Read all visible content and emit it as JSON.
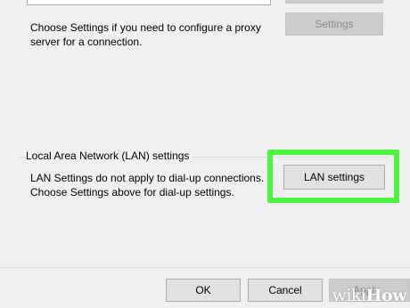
{
  "proxy": {
    "description_line1": "Choose Settings if you need to configure a proxy",
    "description_line2": "server for a connection.",
    "settings_button_label": "Settings"
  },
  "lan": {
    "group_title": "Local Area Network (LAN) settings",
    "description_line1": "LAN Settings do not apply to dial-up connections.",
    "description_line2": "Choose Settings above for dial-up settings.",
    "button_label": "LAN settings"
  },
  "footer": {
    "ok_label": "OK",
    "cancel_label": "Cancel",
    "apply_label": "Apply"
  },
  "watermark": {
    "part1": "wiki",
    "part2": "How"
  },
  "colors": {
    "highlight": "#4cf540",
    "window_bg": "#f0f0f0",
    "button_bg": "#e1e1e1",
    "disabled_text": "#8a8a8a"
  }
}
